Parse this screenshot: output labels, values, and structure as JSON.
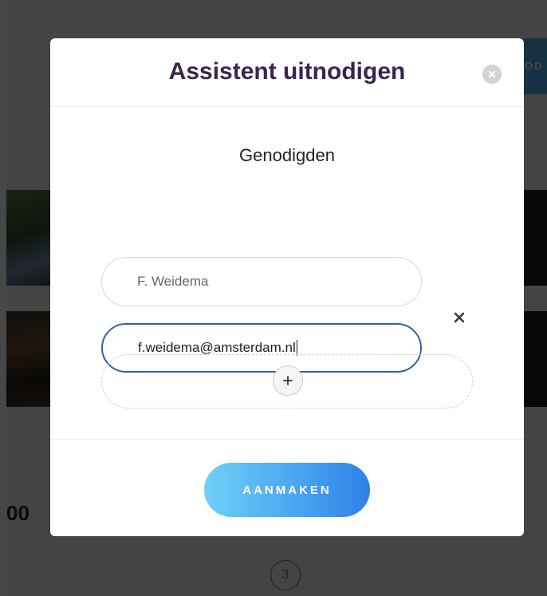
{
  "background": {
    "partial_button_text": "OD",
    "partial_number": "00",
    "page_number": "3"
  },
  "modal": {
    "title": "Assistent uitnodigen",
    "section_title": "Genodigden",
    "invitee": {
      "name_value": "F. Weidema",
      "email_value": "f.weidema@amsterdam.nl"
    },
    "submit_label": "AANMAKEN"
  },
  "icons": {
    "close": "close-icon",
    "remove": "remove-icon",
    "add": "plus-icon"
  },
  "colors": {
    "title": "#3a2450",
    "focus_border": "#2f63a8",
    "button_gradient_start": "#6fd0f6",
    "button_gradient_end": "#2f80e8"
  }
}
